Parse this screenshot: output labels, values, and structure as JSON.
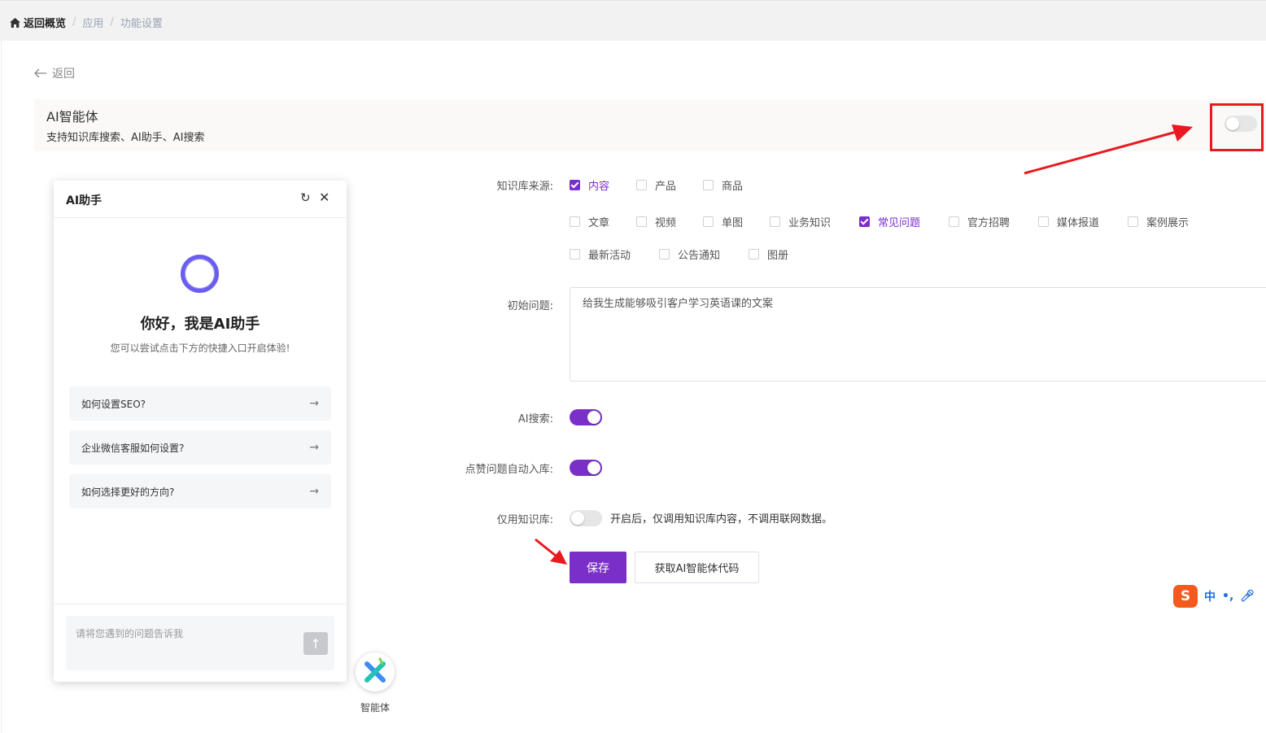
{
  "breadcrumb": {
    "home": "返回概览",
    "items": [
      "应用",
      "功能设置"
    ],
    "separator": "/"
  },
  "back_label": "返回",
  "ai_agent": {
    "title": "AI智能体",
    "description": "支持知识库搜索、AI助手、AI搜索",
    "enabled": false
  },
  "form": {
    "knowledge_source": {
      "label": "知识库来源:",
      "options": [
        {
          "label": "内容",
          "checked": true
        },
        {
          "label": "产品",
          "checked": false
        },
        {
          "label": "商品",
          "checked": false
        },
        {
          "label": "文章",
          "checked": false
        },
        {
          "label": "视频",
          "checked": false
        },
        {
          "label": "单图",
          "checked": false
        },
        {
          "label": "业务知识",
          "checked": false
        },
        {
          "label": "常见问题",
          "checked": true
        },
        {
          "label": "官方招聘",
          "checked": false
        },
        {
          "label": "媒体报道",
          "checked": false
        },
        {
          "label": "案例展示",
          "checked": false
        },
        {
          "label": "最新活动",
          "checked": false
        },
        {
          "label": "公告通知",
          "checked": false
        },
        {
          "label": "图册",
          "checked": false
        }
      ]
    },
    "initial_question": {
      "label": "初始问题:",
      "value": "给我生成能够吸引客户学习英语课的文案"
    },
    "ai_search": {
      "label": "AI搜索:",
      "enabled": true
    },
    "like_auto_store": {
      "label": "点赞问题自动入库:",
      "enabled": true
    },
    "knowledge_only": {
      "label": "仅用知识库:",
      "enabled": false,
      "hint": "开启后，仅调用知识库内容，不调用联网数据。"
    },
    "save_label": "保存",
    "get_code_label": "获取AI智能体代码"
  },
  "assistant": {
    "title": "AI助手",
    "greeting": "你好，我是AI助手",
    "subtitle": "您可以尝试点击下方的快捷入口开启体验!",
    "quick_questions": [
      "如何设置SEO?",
      "企业微信客服如何设置?",
      "如何选择更好的方向?"
    ],
    "input_placeholder": "请将您遇到的问题告诉我"
  },
  "fab_label": "智能体",
  "ime": {
    "logo": "S",
    "mode": "中",
    "punct": "•,"
  },
  "colors": {
    "accent": "#7b2fc9",
    "annotation": "#e8191f",
    "ring": "#6a5df0"
  }
}
